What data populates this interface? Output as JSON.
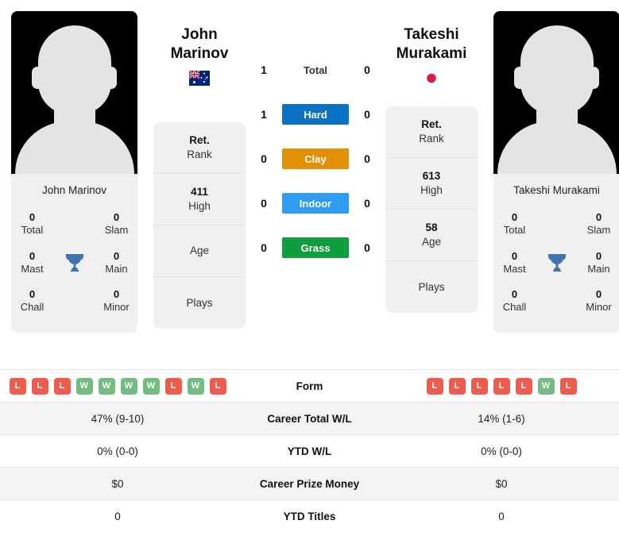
{
  "players": {
    "left": {
      "first_name": "John",
      "last_name": "Marinov",
      "full_name": "John Marinov",
      "flag_icon": "australia-flag-icon",
      "flag_country": "Australia",
      "rank_value": "Ret.",
      "rank_label": "Rank",
      "high_value": "411",
      "high_label": "High",
      "age_value": "",
      "age_label": "Age",
      "plays_value": "",
      "plays_label": "Plays",
      "titles": {
        "total_value": "0",
        "total_label": "Total",
        "slam_value": "0",
        "slam_label": "Slam",
        "mast_value": "0",
        "mast_label": "Mast",
        "main_value": "0",
        "main_label": "Main",
        "chall_value": "0",
        "chall_label": "Chall",
        "minor_value": "0",
        "minor_label": "Minor"
      },
      "form": [
        "L",
        "L",
        "L",
        "W",
        "W",
        "W",
        "W",
        "L",
        "W",
        "L"
      ],
      "career_total_wl": "47% (9-10)",
      "ytd_wl": "0% (0-0)",
      "career_prize_money": "$0",
      "ytd_titles": "0"
    },
    "right": {
      "first_name": "Takeshi",
      "last_name": "Murakami",
      "full_name": "Takeshi Murakami",
      "flag_icon": "japan-flag-icon",
      "flag_country": "Japan",
      "rank_value": "Ret.",
      "rank_label": "Rank",
      "high_value": "613",
      "high_label": "High",
      "age_value": "58",
      "age_label": "Age",
      "plays_value": "",
      "plays_label": "Plays",
      "titles": {
        "total_value": "0",
        "total_label": "Total",
        "slam_value": "0",
        "slam_label": "Slam",
        "mast_value": "0",
        "mast_label": "Mast",
        "main_value": "0",
        "main_label": "Main",
        "chall_value": "0",
        "chall_label": "Chall",
        "minor_value": "0",
        "minor_label": "Minor"
      },
      "form": [
        "L",
        "L",
        "L",
        "L",
        "L",
        "W",
        "L"
      ],
      "career_total_wl": "14% (1-6)",
      "ytd_wl": "0% (0-0)",
      "career_prize_money": "$0",
      "ytd_titles": "0"
    }
  },
  "head_to_head": {
    "rows": [
      {
        "label": "Total",
        "left": "1",
        "right": "0",
        "style": "plain",
        "color": ""
      },
      {
        "label": "Hard",
        "left": "1",
        "right": "0",
        "style": "pill",
        "color": "#0b72c4"
      },
      {
        "label": "Clay",
        "left": "0",
        "right": "0",
        "style": "pill",
        "color": "#e09108"
      },
      {
        "label": "Indoor",
        "left": "0",
        "right": "0",
        "style": "pill",
        "color": "#2f9cf4"
      },
      {
        "label": "Grass",
        "left": "0",
        "right": "0",
        "style": "pill",
        "color": "#0f9d3e"
      }
    ]
  },
  "stats_table": {
    "rows": [
      {
        "label": "Form",
        "type": "form"
      },
      {
        "label": "Career Total W/L",
        "type": "text",
        "left": "47% (9-10)",
        "right": "14% (1-6)"
      },
      {
        "label": "YTD W/L",
        "type": "text",
        "left": "0% (0-0)",
        "right": "0% (0-0)"
      },
      {
        "label": "Career Prize Money",
        "type": "text",
        "left": "$0",
        "right": "$0"
      },
      {
        "label": "YTD Titles",
        "type": "text",
        "left": "0",
        "right": "0"
      }
    ]
  },
  "icons": {
    "trophy": "trophy-icon"
  },
  "colors": {
    "win": "#73bd82",
    "loss": "#ef5b4c",
    "hard": "#0b72c4",
    "clay": "#e09108",
    "indoor": "#2f9cf4",
    "grass": "#0f9d3e",
    "panel": "#f0f0f0",
    "trophy": "#3f74ad"
  }
}
